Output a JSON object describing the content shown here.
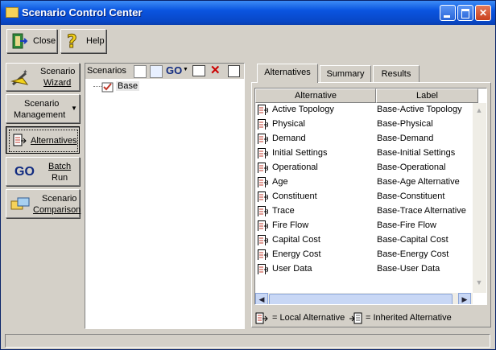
{
  "window": {
    "title": "Scenario Control Center"
  },
  "toolbar": {
    "close_label": "Close",
    "help_label": "Help"
  },
  "left_buttons": [
    {
      "line1": "Scenario",
      "line2": "Wizard"
    },
    {
      "line1": "Scenario",
      "line2": "Management"
    },
    {
      "line1": "Alternatives"
    },
    {
      "line1": "Batch",
      "line2": "Run",
      "go": "GO"
    },
    {
      "line1": "Scenario",
      "line2": "Comparison"
    }
  ],
  "scenarios": {
    "label": "Scenarios",
    "go": "GO",
    "tree_item": "Base"
  },
  "tabs": [
    "Alternatives",
    "Summary",
    "Results"
  ],
  "grid": {
    "headers": [
      "Alternative",
      "Label"
    ],
    "rows": [
      [
        "Active Topology",
        "Base-Active Topology"
      ],
      [
        "Physical",
        "Base-Physical"
      ],
      [
        "Demand",
        "Base-Demand"
      ],
      [
        "Initial Settings",
        "Base-Initial Settings"
      ],
      [
        "Operational",
        "Base-Operational"
      ],
      [
        "Age",
        "Base-Age Alternative"
      ],
      [
        "Constituent",
        "Base-Constituent"
      ],
      [
        "Trace",
        "Base-Trace Alternative"
      ],
      [
        "Fire Flow",
        "Base-Fire Flow"
      ],
      [
        "Capital Cost",
        "Base-Capital Cost"
      ],
      [
        "Energy Cost",
        "Base-Energy Cost"
      ],
      [
        "User Data",
        "Base-User Data"
      ]
    ]
  },
  "legend": {
    "local": "= Local Alternative",
    "inherited": "= Inherited Alternative"
  }
}
